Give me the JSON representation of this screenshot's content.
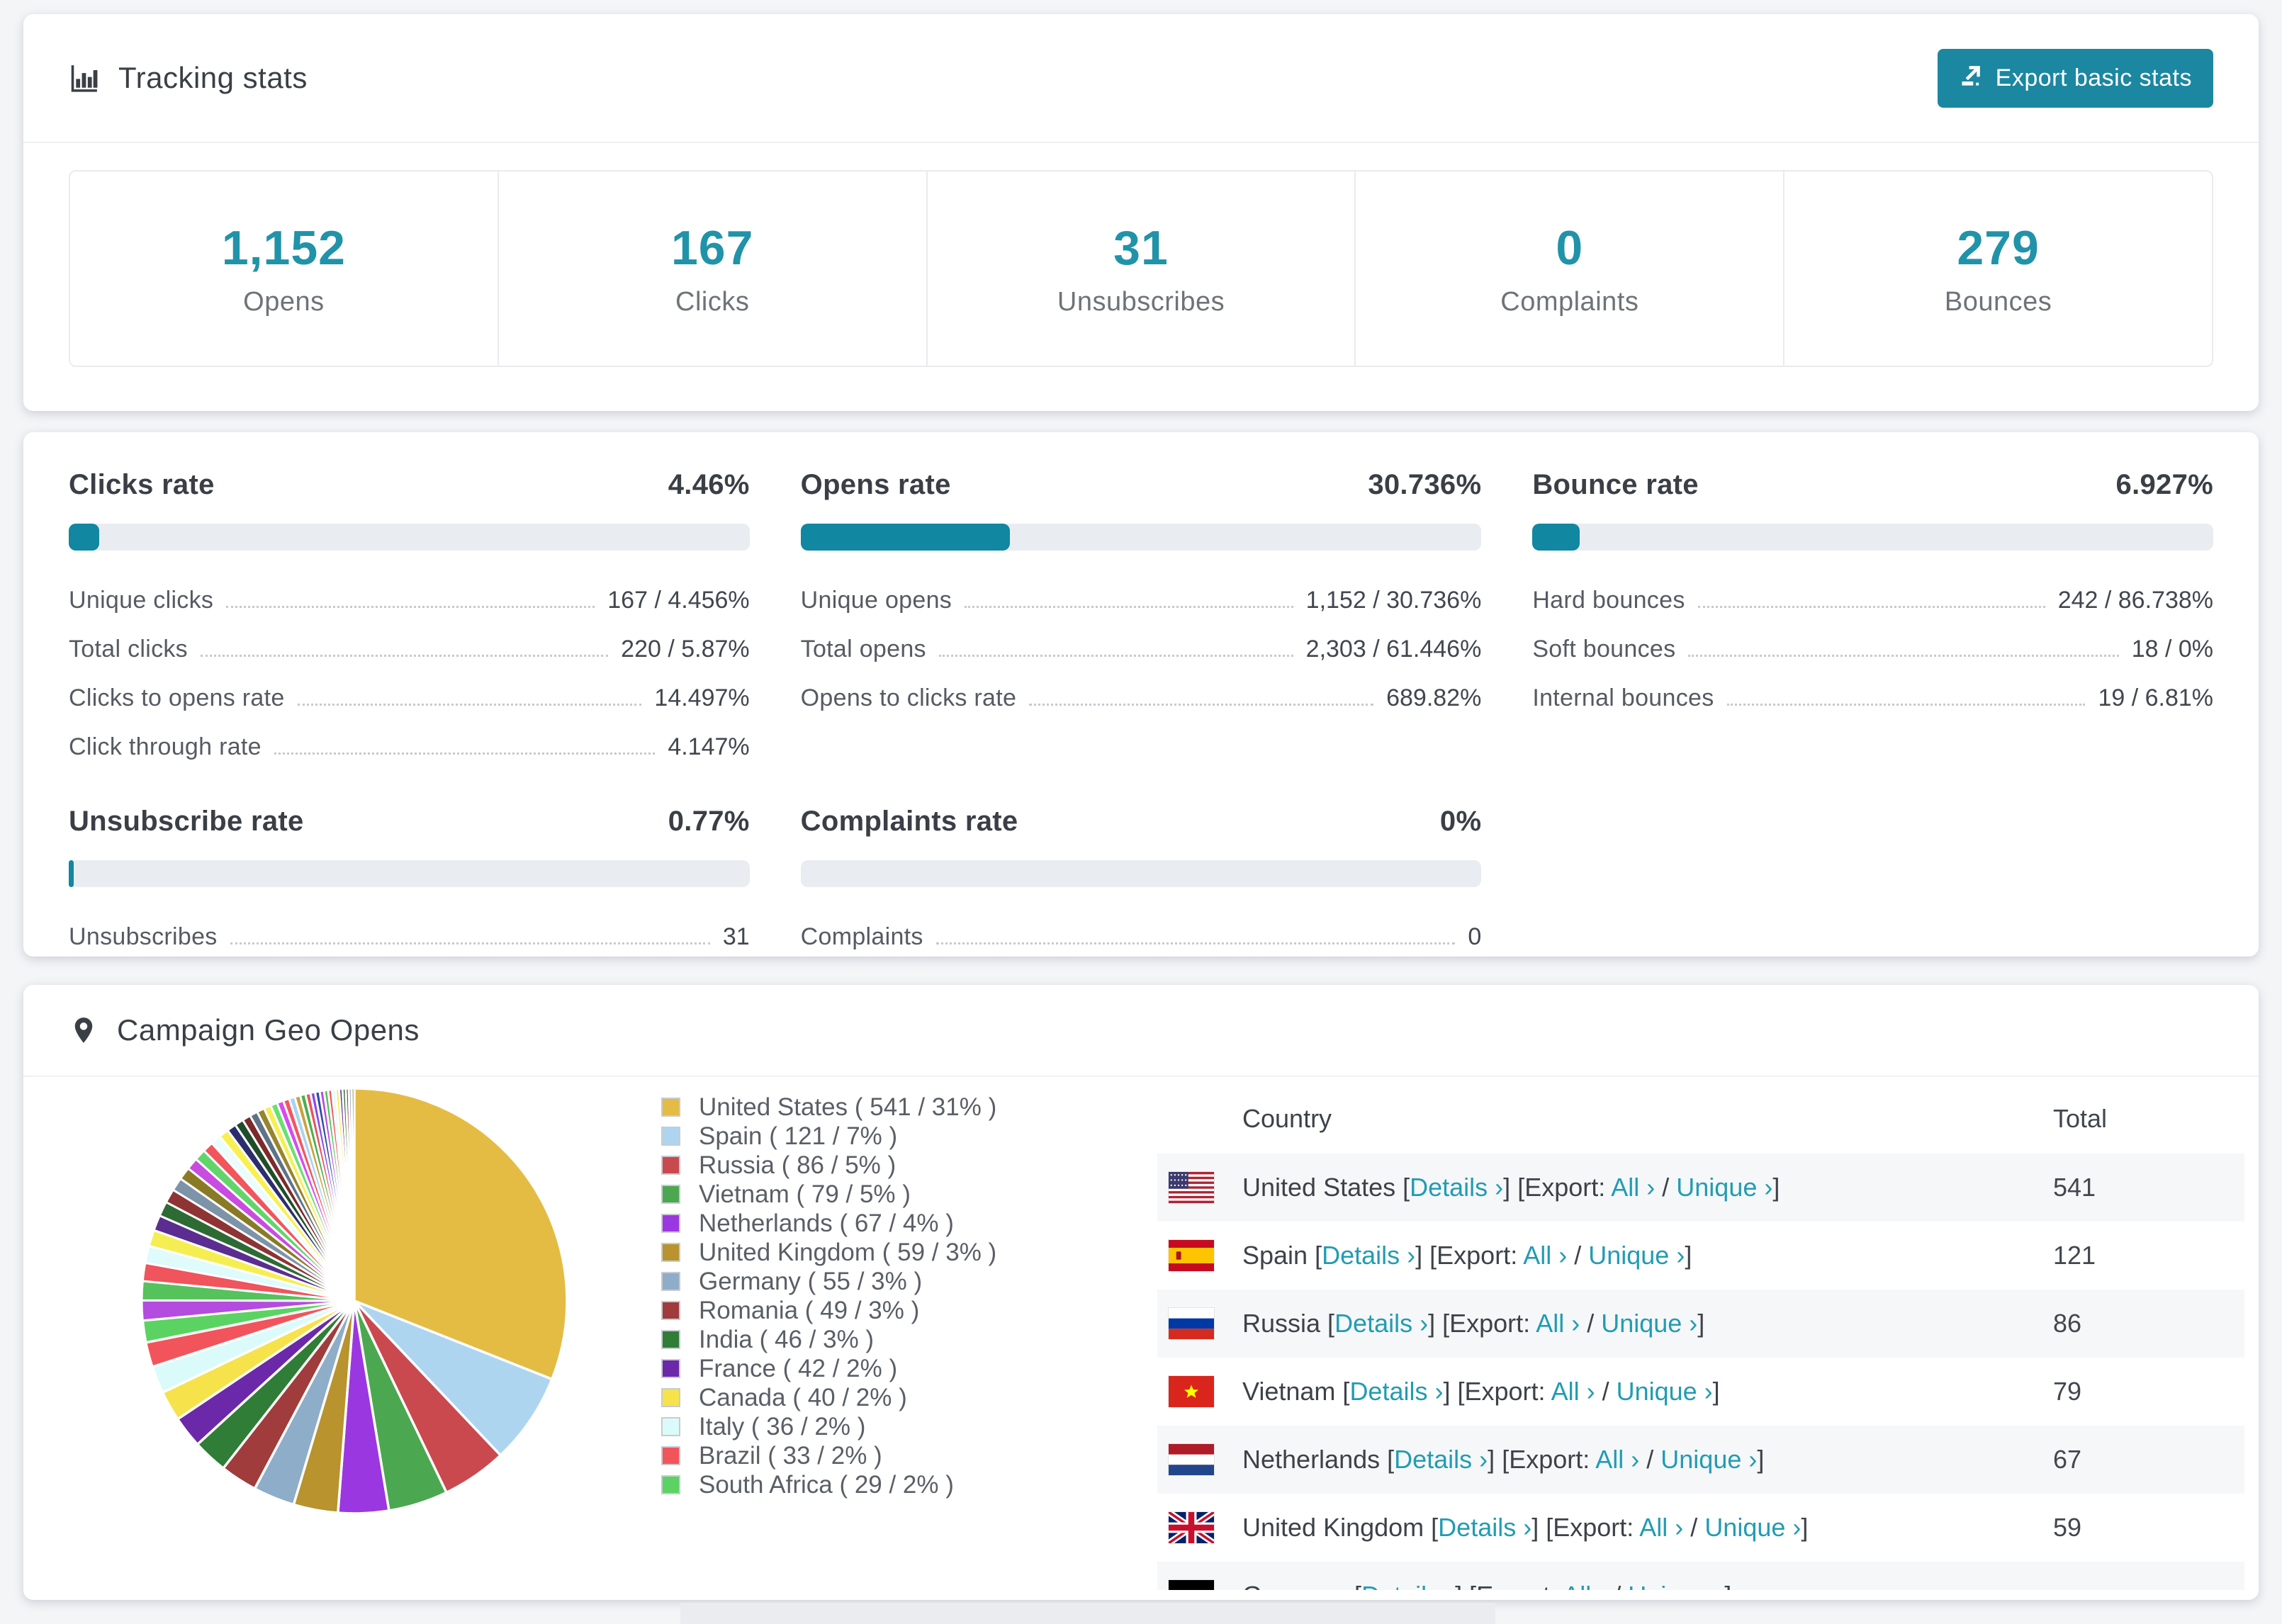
{
  "colors": {
    "accent_teal": "#1b87a1",
    "stat_number_teal": "#2093a9",
    "link_teal": "#219cb3",
    "bar_fill_teal": "#1187a1",
    "row_stripe": "#f6f7f8"
  },
  "tracking": {
    "title": "Tracking stats",
    "export_label": "Export basic stats",
    "summary": [
      {
        "value": "1,152",
        "label": "Opens"
      },
      {
        "value": "167",
        "label": "Clicks"
      },
      {
        "value": "31",
        "label": "Unsubscribes"
      },
      {
        "value": "0",
        "label": "Complaints"
      },
      {
        "value": "279",
        "label": "Bounces"
      }
    ]
  },
  "rates": [
    {
      "title": "Clicks rate",
      "value": "4.46%",
      "pct": 4.46,
      "rows": [
        {
          "label": "Unique clicks",
          "value": "167 / 4.456%"
        },
        {
          "label": "Total clicks",
          "value": "220 / 5.87%"
        },
        {
          "label": "Clicks to opens rate",
          "value": "14.497%"
        },
        {
          "label": "Click through rate",
          "value": "4.147%"
        }
      ]
    },
    {
      "title": "Opens rate",
      "value": "30.736%",
      "pct": 30.736,
      "rows": [
        {
          "label": "Unique opens",
          "value": "1,152 / 30.736%"
        },
        {
          "label": "Total opens",
          "value": "2,303 / 61.446%"
        },
        {
          "label": "Opens to clicks rate",
          "value": "689.82%"
        }
      ]
    },
    {
      "title": "Bounce rate",
      "value": "6.927%",
      "pct": 6.927,
      "rows": [
        {
          "label": "Hard bounces",
          "value": "242 / 86.738%"
        },
        {
          "label": "Soft bounces",
          "value": "18 / 0%"
        },
        {
          "label": "Internal bounces",
          "value": "19 / 6.81%"
        }
      ]
    },
    {
      "title": "Unsubscribe rate",
      "value": "0.77%",
      "pct": 0.77,
      "rows": [
        {
          "label": "Unsubscribes",
          "value": "31"
        }
      ]
    },
    {
      "title": "Complaints rate",
      "value": "0%",
      "pct": 0,
      "rows": [
        {
          "label": "Complaints",
          "value": "0"
        }
      ]
    }
  ],
  "geo": {
    "title": "Campaign Geo Opens",
    "table": {
      "columns": [
        "Country",
        "Total"
      ],
      "details_label": "Details ›",
      "export_prefix": "[Export:",
      "all_label": "All ›",
      "unique_label": "Unique ›",
      "rows": [
        {
          "country": "United States",
          "flag": "us",
          "total": "541",
          "partial": false
        },
        {
          "country": "Spain",
          "flag": "es",
          "total": "121",
          "partial": false
        },
        {
          "country": "Russia",
          "flag": "ru",
          "total": "86",
          "partial": false
        },
        {
          "country": "Vietnam",
          "flag": "vn",
          "total": "79",
          "partial": false
        },
        {
          "country": "Netherlands",
          "flag": "nl",
          "total": "67",
          "partial": false
        },
        {
          "country": "United Kingdom",
          "flag": "gb",
          "total": "59",
          "partial": false
        },
        {
          "country": "Germany",
          "flag": "de",
          "total": "",
          "partial": true
        }
      ]
    }
  },
  "chart_data": {
    "type": "pie",
    "title": "Campaign Geo Opens",
    "labels": [
      "United States",
      "Spain",
      "Russia",
      "Vietnam",
      "Netherlands",
      "United Kingdom",
      "Germany",
      "Romania",
      "India",
      "France",
      "Canada",
      "Italy",
      "Brazil",
      "South Africa"
    ],
    "values": [
      541,
      121,
      86,
      79,
      67,
      59,
      55,
      49,
      46,
      42,
      40,
      36,
      33,
      29
    ],
    "percent_labels": [
      "31%",
      "7%",
      "5%",
      "5%",
      "4%",
      "3%",
      "3%",
      "3%",
      "3%",
      "2%",
      "2%",
      "2%",
      "2%",
      "2%"
    ],
    "colors": [
      "#e4bc44",
      "#aed5f0",
      "#c9494f",
      "#4ba850",
      "#9b37e0",
      "#b8932e",
      "#8dadc8",
      "#a03c3c",
      "#2f7d36",
      "#6b28a8",
      "#f6e24b",
      "#dbfbfa",
      "#f2545c",
      "#5bd363"
    ],
    "total_estimate": 1745,
    "others_total_estimate": 462,
    "others_colors": [
      "#b44ce0",
      "#56c25c",
      "#f0545c",
      "#dffbfb",
      "#f5ee52",
      "#5b2d91",
      "#2e6b34",
      "#8e3434",
      "#7d93a8",
      "#8a7a26",
      "#c94ce0",
      "#62d56a",
      "#f2555c",
      "#eafcfc",
      "#f8f050",
      "#2b2d6e",
      "#1f4d2a",
      "#7c2a2a",
      "#5d7388",
      "#97852c",
      "#f5ef55",
      "#6adf72",
      "#d44cf0",
      "#f45560",
      "#a8d4f0",
      "#caa23a",
      "#4caf50",
      "#e8555f",
      "#8a4ce8",
      "#2f4da0"
    ],
    "legend_position": "right"
  }
}
